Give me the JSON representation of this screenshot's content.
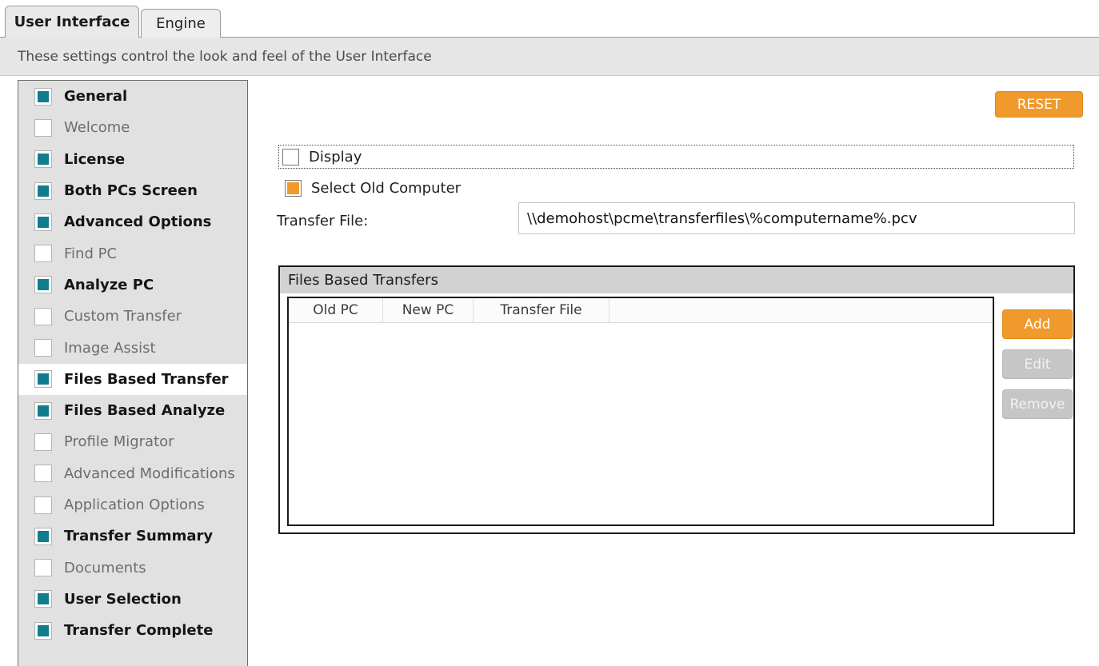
{
  "tabs": [
    {
      "label": "User Interface",
      "active": true
    },
    {
      "label": "Engine",
      "active": false
    }
  ],
  "description": "These settings control the look and feel of the User Interface",
  "colors": {
    "accent_orange": "#f09a2c",
    "accent_teal": "#0f7d8c",
    "disabled_gray": "#c6c6c6",
    "sidebar_bg": "#e1e1e1",
    "descbar_bg": "#e6e6e6"
  },
  "sidebar": {
    "items": [
      {
        "label": "General",
        "checked": true,
        "selected": false
      },
      {
        "label": "Welcome",
        "checked": false,
        "selected": false
      },
      {
        "label": "License",
        "checked": true,
        "selected": false
      },
      {
        "label": "Both PCs Screen",
        "checked": true,
        "selected": false
      },
      {
        "label": "Advanced Options",
        "checked": true,
        "selected": false
      },
      {
        "label": "Find PC",
        "checked": false,
        "selected": false
      },
      {
        "label": "Analyze PC",
        "checked": true,
        "selected": false
      },
      {
        "label": "Custom Transfer",
        "checked": false,
        "selected": false
      },
      {
        "label": "Image Assist",
        "checked": false,
        "selected": false
      },
      {
        "label": "Files Based Transfer",
        "checked": true,
        "selected": true
      },
      {
        "label": "Files Based Analyze",
        "checked": true,
        "selected": false
      },
      {
        "label": "Profile Migrator",
        "checked": false,
        "selected": false
      },
      {
        "label": "Advanced Modifications",
        "checked": false,
        "selected": false
      },
      {
        "label": "Application Options",
        "checked": false,
        "selected": false
      },
      {
        "label": "Transfer Summary",
        "checked": true,
        "selected": false
      },
      {
        "label": "Documents",
        "checked": false,
        "selected": false
      },
      {
        "label": "User Selection",
        "checked": true,
        "selected": false
      },
      {
        "label": "Transfer Complete",
        "checked": true,
        "selected": false
      }
    ]
  },
  "panel": {
    "reset_label": "RESET",
    "display_checkbox": {
      "label": "Display",
      "checked": false,
      "focused": true
    },
    "select_old_computer_checkbox": {
      "label": "Select Old Computer",
      "checked": true
    },
    "transfer_file": {
      "label": "Transfer File:",
      "value": "\\\\demohost\\pcme\\transferfiles\\%computername%.pcv",
      "placeholder": ""
    },
    "groupbox": {
      "title": "Files Based Transfers",
      "columns": [
        "Old PC",
        "New PC",
        "Transfer File",
        ""
      ],
      "rows": [],
      "buttons": [
        {
          "label": "Add",
          "enabled": true
        },
        {
          "label": "Edit",
          "enabled": false
        },
        {
          "label": "Remove",
          "enabled": false
        }
      ]
    }
  }
}
